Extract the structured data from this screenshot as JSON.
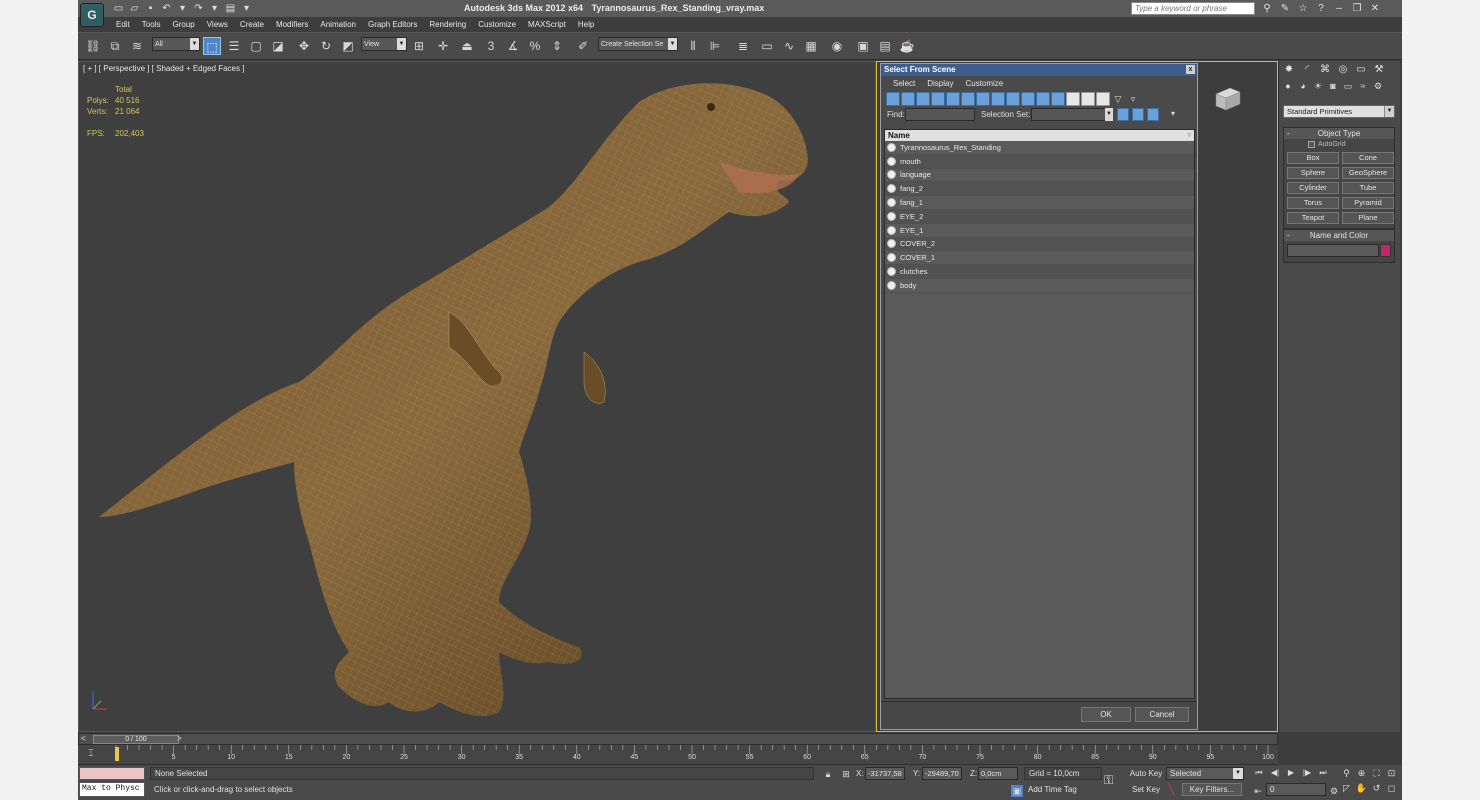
{
  "app": {
    "logo": "G",
    "title": "Autodesk 3ds Max  2012 x64",
    "filename": "Tyrannosaurus_Rex_Standing_vray.max",
    "search_placeholder": "Type a keyword or phrase"
  },
  "menus": [
    "Edit",
    "Tools",
    "Group",
    "Views",
    "Create",
    "Modifiers",
    "Animation",
    "Graph Editors",
    "Rendering",
    "Customize",
    "MAXScript",
    "Help"
  ],
  "toolbar": {
    "filter_dropdown": "All",
    "refcoord_dropdown": "View",
    "selection_set": "Create Selection Se",
    "snap_label": "3"
  },
  "viewport": {
    "label": "[ + ] [ Perspective ] [ Shaded + Edged Faces ]",
    "stats": {
      "header": "Total",
      "polys_label": "Polys:",
      "polys": "40 516",
      "verts_label": "Verts:",
      "verts": "21 064",
      "fps_label": "FPS:",
      "fps": "202,403"
    }
  },
  "select_from_scene": {
    "title": "Select From Scene",
    "close": "x",
    "menus": [
      "Select",
      "Display",
      "Customize"
    ],
    "find_label": "Find:",
    "selection_set_label": "Selection Set:",
    "column_name": "Name",
    "items": [
      "Tyrannosaurus_Rex_Standing",
      "mouth",
      "language",
      "fang_2",
      "fang_1",
      "EYE_2",
      "EYE_1",
      "COVER_2",
      "COVER_1",
      "clutches",
      "body"
    ],
    "ok": "OK",
    "cancel": "Cancel"
  },
  "command_panel": {
    "category_dropdown": "Standard Primitives",
    "object_type_title": "Object Type",
    "autogrid": "AutoGrid",
    "primitives": [
      "Box",
      "Cone",
      "Sphere",
      "GeoSphere",
      "Cylinder",
      "Tube",
      "Torus",
      "Pyramid",
      "Teapot",
      "Plane"
    ],
    "name_color_title": "Name and Color",
    "object_color": "#c2276e"
  },
  "time_slider": {
    "value": "0 / 100",
    "prev": "<",
    "next": ">",
    "ticks": [
      5,
      10,
      15,
      20,
      25,
      30,
      35,
      40,
      45,
      50,
      55,
      60,
      65,
      70,
      75,
      80,
      85,
      90,
      95,
      100
    ]
  },
  "status": {
    "maxscript": "Max to Physc",
    "selection": "None Selected",
    "prompt": "Click or click-and-drag to select objects",
    "x_label": "X:",
    "x": "-31737,58",
    "y_label": "Y:",
    "y": "-29489,70",
    "z_label": "Z:",
    "z": "0,0cm",
    "grid": "Grid = 10,0cm",
    "add_time_tag": "Add Time Tag",
    "auto_key": "Auto Key",
    "set_key": "Set Key",
    "key_mode": "Selected",
    "key_filters": "Key Filters...",
    "frame": "0"
  }
}
